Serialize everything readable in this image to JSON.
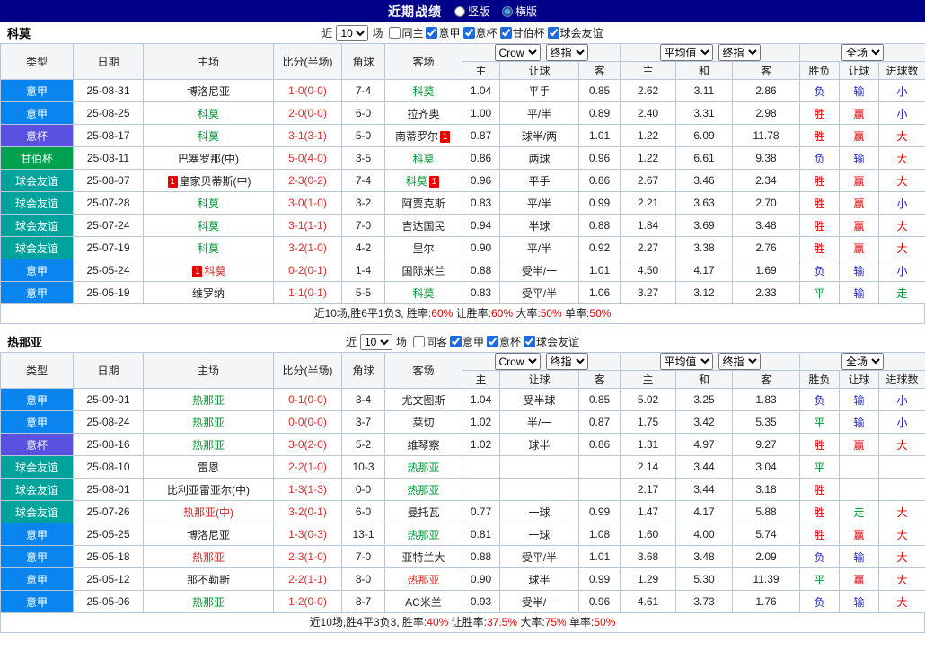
{
  "topbar": {
    "title": "近期战绩",
    "radio_vertical": "竖版",
    "radio_horizontal": "横版",
    "selected": "横版"
  },
  "filter": {
    "near": "近",
    "games": "场",
    "count": "10"
  },
  "columns": {
    "type": "类型",
    "date": "日期",
    "home": "主场",
    "score": "比分(半场)",
    "corner": "角球",
    "away": "客场",
    "asia_home": "主",
    "asia_line": "让球",
    "asia_away": "客",
    "euro_home": "主",
    "euro_draw": "和",
    "euro_away": "客",
    "result": "胜负",
    "handicap": "让球",
    "goals": "进球数"
  },
  "header_selects": {
    "company": "Crow",
    "stage": "终指",
    "euro": "平均值",
    "scope": "全场"
  },
  "colors": {
    "topbar_bg": "#000089",
    "border": "#b9c6da",
    "header_bg": "#f4f5f7",
    "score": "#d43030",
    "summary_value": "#ee0000",
    "team": {
      "g": "#009933",
      "r": "#dd2222",
      "k": "#222222"
    },
    "types": {
      "意甲": "#0a85f0",
      "意杯": "#5a50e0",
      "甘伯杯": "#00a14e",
      "球会友谊": "#00a39b"
    },
    "results": {
      "胜": "#e60000",
      "赢": "#e60000",
      "大": "#e60000",
      "负": "#2222dd",
      "输": "#2222dd",
      "小": "#2222dd",
      "平": "#009933",
      "走": "#009933"
    }
  },
  "tables": [
    {
      "team": "科莫",
      "filters": [
        {
          "label": "同主",
          "checked": false
        },
        {
          "label": "意甲",
          "checked": true
        },
        {
          "label": "意杯",
          "checked": true
        },
        {
          "label": "甘伯杯",
          "checked": true
        },
        {
          "label": "球会友谊",
          "checked": true
        }
      ],
      "rows": [
        {
          "type": "意甲",
          "date": "25-08-31",
          "home": {
            "n": "博洛尼亚",
            "c": "k"
          },
          "score": "1-0(0-0)",
          "corner": "7-4",
          "away": {
            "n": "科莫",
            "c": "g"
          },
          "asia": [
            "1.04",
            "平手",
            "0.85"
          ],
          "euro": [
            "2.62",
            "3.11",
            "2.86"
          ],
          "res": [
            "负",
            "输",
            "小"
          ]
        },
        {
          "type": "意甲",
          "date": "25-08-25",
          "home": {
            "n": "科莫",
            "c": "g"
          },
          "score": "2-0(0-0)",
          "corner": "6-0",
          "away": {
            "n": "拉齐奥",
            "c": "k"
          },
          "asia": [
            "1.00",
            "平/半",
            "0.89"
          ],
          "euro": [
            "2.40",
            "3.31",
            "2.98"
          ],
          "res": [
            "胜",
            "赢",
            "小"
          ]
        },
        {
          "type": "意杯",
          "date": "25-08-17",
          "home": {
            "n": "科莫",
            "c": "g"
          },
          "score": "3-1(3-1)",
          "corner": "5-0",
          "away": {
            "n": "南蒂罗尔",
            "c": "k",
            "ba": "1"
          },
          "asia": [
            "0.87",
            "球半/两",
            "1.01"
          ],
          "euro": [
            "1.22",
            "6.09",
            "11.78"
          ],
          "res": [
            "胜",
            "赢",
            "大"
          ]
        },
        {
          "type": "甘伯杯",
          "date": "25-08-11",
          "home": {
            "n": "巴塞罗那(中)",
            "c": "k"
          },
          "score": "5-0(4-0)",
          "corner": "3-5",
          "away": {
            "n": "科莫",
            "c": "g"
          },
          "asia": [
            "0.86",
            "两球",
            "0.96"
          ],
          "euro": [
            "1.22",
            "6.61",
            "9.38"
          ],
          "res": [
            "负",
            "输",
            "大"
          ]
        },
        {
          "type": "球会友谊",
          "date": "25-08-07",
          "home": {
            "n": "皇家贝蒂斯(中)",
            "c": "k",
            "bb": "1"
          },
          "score": "2-3(0-2)",
          "corner": "7-4",
          "away": {
            "n": "科莫",
            "c": "g",
            "ba": "1"
          },
          "asia": [
            "0.96",
            "平手",
            "0.86"
          ],
          "euro": [
            "2.67",
            "3.46",
            "2.34"
          ],
          "res": [
            "胜",
            "赢",
            "大"
          ]
        },
        {
          "type": "球会友谊",
          "date": "25-07-28",
          "home": {
            "n": "科莫",
            "c": "g"
          },
          "score": "3-0(1-0)",
          "corner": "3-2",
          "away": {
            "n": "阿贾克斯",
            "c": "k"
          },
          "asia": [
            "0.83",
            "平/半",
            "0.99"
          ],
          "euro": [
            "2.21",
            "3.63",
            "2.70"
          ],
          "res": [
            "胜",
            "赢",
            "小"
          ]
        },
        {
          "type": "球会友谊",
          "date": "25-07-24",
          "home": {
            "n": "科莫",
            "c": "g"
          },
          "score": "3-1(1-1)",
          "corner": "7-0",
          "away": {
            "n": "吉达国民",
            "c": "k"
          },
          "asia": [
            "0.94",
            "半球",
            "0.88"
          ],
          "euro": [
            "1.84",
            "3.69",
            "3.48"
          ],
          "res": [
            "胜",
            "赢",
            "大"
          ]
        },
        {
          "type": "球会友谊",
          "date": "25-07-19",
          "home": {
            "n": "科莫",
            "c": "g"
          },
          "score": "3-2(1-0)",
          "corner": "4-2",
          "away": {
            "n": "里尔",
            "c": "k"
          },
          "asia": [
            "0.90",
            "平/半",
            "0.92"
          ],
          "euro": [
            "2.27",
            "3.38",
            "2.76"
          ],
          "res": [
            "胜",
            "赢",
            "大"
          ]
        },
        {
          "type": "意甲",
          "date": "25-05-24",
          "home": {
            "n": "科莫",
            "c": "r",
            "bb": "1"
          },
          "score": "0-2(0-1)",
          "corner": "1-4",
          "away": {
            "n": "国际米兰",
            "c": "k"
          },
          "asia": [
            "0.88",
            "受半/一",
            "1.01"
          ],
          "euro": [
            "4.50",
            "4.17",
            "1.69"
          ],
          "res": [
            "负",
            "输",
            "小"
          ]
        },
        {
          "type": "意甲",
          "date": "25-05-19",
          "home": {
            "n": "维罗纳",
            "c": "k"
          },
          "score": "1-1(0-1)",
          "corner": "5-5",
          "away": {
            "n": "科莫",
            "c": "g"
          },
          "asia": [
            "0.83",
            "受平/半",
            "1.06"
          ],
          "euro": [
            "3.27",
            "3.12",
            "2.33"
          ],
          "res": [
            "平",
            "输",
            "走"
          ]
        }
      ],
      "summary": [
        {
          "t": "近10场,胜6平1负3, 胜率:",
          "r": false
        },
        {
          "t": "60%",
          "r": true
        },
        {
          "t": " 让胜率:",
          "r": false
        },
        {
          "t": "60%",
          "r": true
        },
        {
          "t": " 大率:",
          "r": false
        },
        {
          "t": "50%",
          "r": true
        },
        {
          "t": " 单率:",
          "r": false
        },
        {
          "t": "50%",
          "r": true
        }
      ]
    },
    {
      "team": "热那亚",
      "filters": [
        {
          "label": "同客",
          "checked": false
        },
        {
          "label": "意甲",
          "checked": true
        },
        {
          "label": "意杯",
          "checked": true
        },
        {
          "label": "球会友谊",
          "checked": true
        }
      ],
      "rows": [
        {
          "type": "意甲",
          "date": "25-09-01",
          "home": {
            "n": "热那亚",
            "c": "g"
          },
          "score": "0-1(0-0)",
          "corner": "3-4",
          "away": {
            "n": "尤文图斯",
            "c": "k"
          },
          "asia": [
            "1.04",
            "受半球",
            "0.85"
          ],
          "euro": [
            "5.02",
            "3.25",
            "1.83"
          ],
          "res": [
            "负",
            "输",
            "小"
          ]
        },
        {
          "type": "意甲",
          "date": "25-08-24",
          "home": {
            "n": "热那亚",
            "c": "g"
          },
          "score": "0-0(0-0)",
          "corner": "3-7",
          "away": {
            "n": "莱切",
            "c": "k"
          },
          "asia": [
            "1.02",
            "半/一",
            "0.87"
          ],
          "euro": [
            "1.75",
            "3.42",
            "5.35"
          ],
          "res": [
            "平",
            "输",
            "小"
          ]
        },
        {
          "type": "意杯",
          "date": "25-08-16",
          "home": {
            "n": "热那亚",
            "c": "g"
          },
          "score": "3-0(2-0)",
          "corner": "5-2",
          "away": {
            "n": "维琴察",
            "c": "k"
          },
          "asia": [
            "1.02",
            "球半",
            "0.86"
          ],
          "euro": [
            "1.31",
            "4.97",
            "9.27"
          ],
          "res": [
            "胜",
            "赢",
            "大"
          ]
        },
        {
          "type": "球会友谊",
          "date": "25-08-10",
          "home": {
            "n": "雷恩",
            "c": "k"
          },
          "score": "2-2(1-0)",
          "corner": "10-3",
          "away": {
            "n": "热那亚",
            "c": "g"
          },
          "asia": [
            "",
            "",
            ""
          ],
          "euro": [
            "2.14",
            "3.44",
            "3.04"
          ],
          "res": [
            "平",
            "",
            ""
          ]
        },
        {
          "type": "球会友谊",
          "date": "25-08-01",
          "home": {
            "n": "比利亚雷亚尔(中)",
            "c": "k"
          },
          "score": "1-3(1-3)",
          "corner": "0-0",
          "away": {
            "n": "热那亚",
            "c": "g"
          },
          "asia": [
            "",
            "",
            ""
          ],
          "euro": [
            "2.17",
            "3.44",
            "3.18"
          ],
          "res": [
            "胜",
            "",
            ""
          ]
        },
        {
          "type": "球会友谊",
          "date": "25-07-26",
          "home": {
            "n": "热那亚(中)",
            "c": "r"
          },
          "score": "3-2(0-1)",
          "corner": "6-0",
          "away": {
            "n": "曼托瓦",
            "c": "k"
          },
          "asia": [
            "0.77",
            "一球",
            "0.99"
          ],
          "euro": [
            "1.47",
            "4.17",
            "5.88"
          ],
          "res": [
            "胜",
            "走",
            "大"
          ]
        },
        {
          "type": "意甲",
          "date": "25-05-25",
          "home": {
            "n": "博洛尼亚",
            "c": "k"
          },
          "score": "1-3(0-3)",
          "corner": "13-1",
          "away": {
            "n": "热那亚",
            "c": "g"
          },
          "asia": [
            "0.81",
            "一球",
            "1.08"
          ],
          "euro": [
            "1.60",
            "4.00",
            "5.74"
          ],
          "res": [
            "胜",
            "赢",
            "大"
          ]
        },
        {
          "type": "意甲",
          "date": "25-05-18",
          "home": {
            "n": "热那亚",
            "c": "r"
          },
          "score": "2-3(1-0)",
          "corner": "7-0",
          "away": {
            "n": "亚特兰大",
            "c": "k"
          },
          "asia": [
            "0.88",
            "受平/半",
            "1.01"
          ],
          "euro": [
            "3.68",
            "3.48",
            "2.09"
          ],
          "res": [
            "负",
            "输",
            "大"
          ]
        },
        {
          "type": "意甲",
          "date": "25-05-12",
          "home": {
            "n": "那不勒斯",
            "c": "k"
          },
          "score": "2-2(1-1)",
          "corner": "8-0",
          "away": {
            "n": "热那亚",
            "c": "r"
          },
          "asia": [
            "0.90",
            "球半",
            "0.99"
          ],
          "euro": [
            "1.29",
            "5.30",
            "11.39"
          ],
          "res": [
            "平",
            "赢",
            "大"
          ]
        },
        {
          "type": "意甲",
          "date": "25-05-06",
          "home": {
            "n": "热那亚",
            "c": "g"
          },
          "score": "1-2(0-0)",
          "corner": "8-7",
          "away": {
            "n": "AC米兰",
            "c": "k"
          },
          "asia": [
            "0.93",
            "受半/一",
            "0.96"
          ],
          "euro": [
            "4.61",
            "3.73",
            "1.76"
          ],
          "res": [
            "负",
            "输",
            "大"
          ]
        }
      ],
      "summary": [
        {
          "t": "近10场,胜4平3负3, 胜率:",
          "r": false
        },
        {
          "t": "40%",
          "r": true
        },
        {
          "t": " 让胜率:",
          "r": false
        },
        {
          "t": "37.5%",
          "r": true
        },
        {
          "t": " 大率:",
          "r": false
        },
        {
          "t": "75%",
          "r": true
        },
        {
          "t": " 单率:",
          "r": false
        },
        {
          "t": "50%",
          "r": true
        }
      ]
    }
  ]
}
